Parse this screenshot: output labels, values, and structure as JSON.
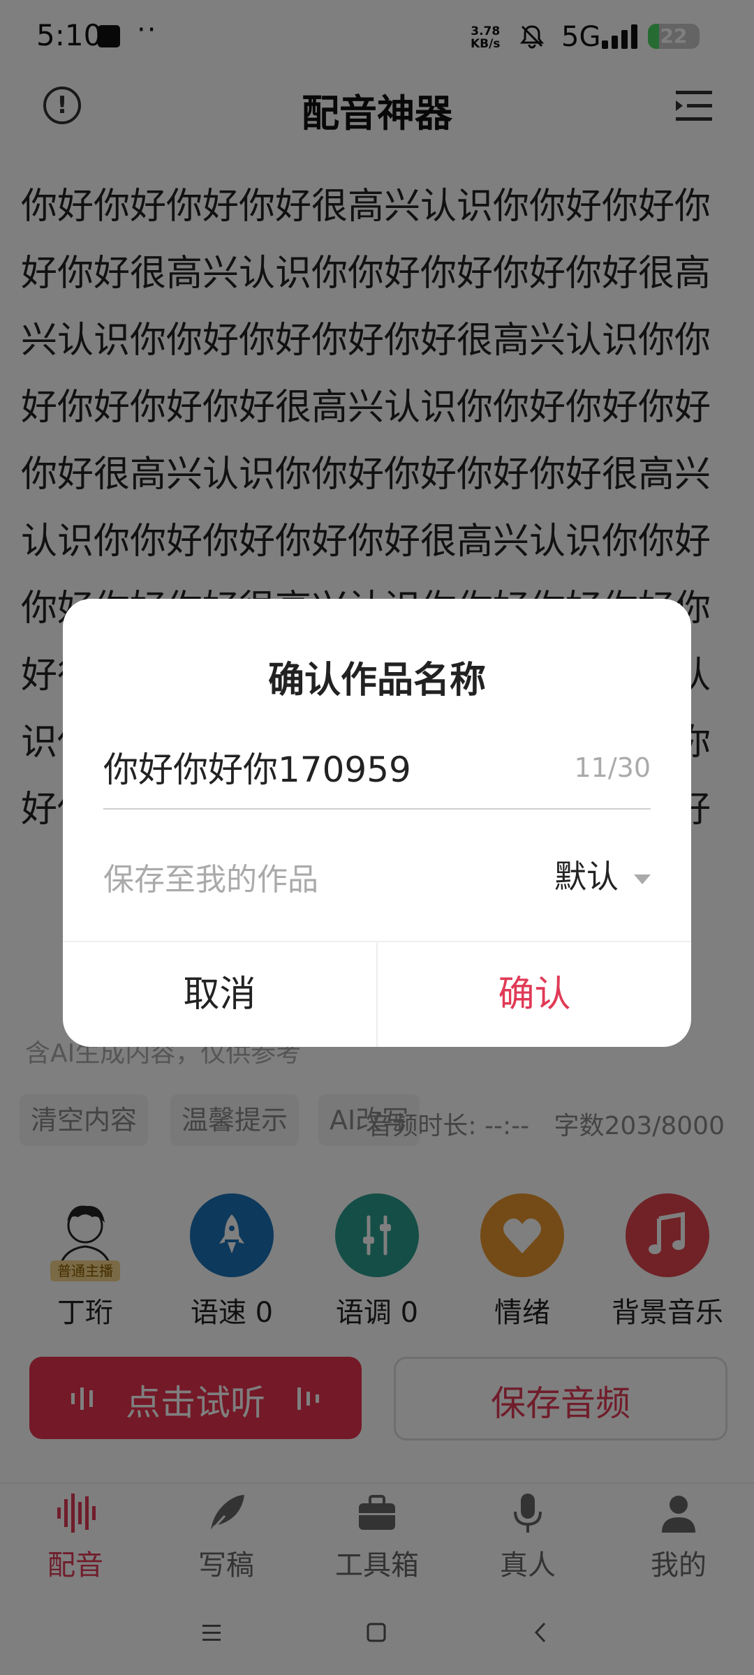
{
  "status_bar": {
    "time": "5:10",
    "dots": "··",
    "net_speed_value": "3.78",
    "net_speed_unit": "KB/s",
    "network": "5G",
    "battery": "22",
    "battery_level": 0.22,
    "icons": [
      "image-square-icon",
      "mute-bell-icon",
      "signal-icon",
      "battery-charging-icon"
    ]
  },
  "header": {
    "title": "配音神器",
    "icons": [
      "info-icon",
      "menu-icon"
    ]
  },
  "editor": {
    "text": "你好你好你好你好很高兴认识你你好你好你好你好很高兴认识你你好你好你好你好很高兴认识你你好你好你好你好很高兴认识你你好你好你好你好很高兴认识你你好你好你好你好很高兴认识你你好你好你好你好很高兴认识你你好你好你好你好很高兴认识你你好你好你好你好很高兴认识你你好你好你好你好很高兴认识你你好你好你好你好很高兴认识你你好你好你好你好很高兴认识你你好你好你好你好很高兴认识你你好你好你好你好",
    "ai_note": "含AI生成内容，仅供参考"
  },
  "actions": {
    "clear": "清空内容",
    "tips": "温馨提示",
    "ai_rewrite": "AI改写",
    "duration_label": "音频时长: --:--",
    "char_count": "字数203/8000"
  },
  "tools": [
    {
      "label": "丁珩",
      "badge": "普通主播",
      "icon": "voice-actor-avatar-icon"
    },
    {
      "label": "语速 0",
      "icon": "rocket-icon",
      "color": "#1a73b8"
    },
    {
      "label": "语调 0",
      "icon": "sliders-icon",
      "color": "#2a9d8f"
    },
    {
      "label": "情绪",
      "icon": "heart-icon",
      "color": "#e8962e"
    },
    {
      "label": "背景音乐",
      "icon": "music-note-icon",
      "color": "#e0444f"
    }
  ],
  "buttons": {
    "listen": "点击试听",
    "save_audio": "保存音频"
  },
  "bottom_nav": [
    {
      "label": "配音",
      "icon": "waveform-icon",
      "active": true
    },
    {
      "label": "写稿",
      "icon": "feather-icon",
      "active": false
    },
    {
      "label": "工具箱",
      "icon": "toolbox-icon",
      "active": false
    },
    {
      "label": "真人",
      "icon": "microphone-icon",
      "active": false
    },
    {
      "label": "我的",
      "icon": "person-icon",
      "active": false
    }
  ],
  "dialog": {
    "title": "确认作品名称",
    "name_value": "你好你好你170959",
    "name_count": "11/30",
    "save_to_label": "保存至我的作品",
    "folder_value": "默认",
    "cancel": "取消",
    "confirm": "确认"
  },
  "colors": {
    "accent": "#e03a56",
    "listen_button": "#e8334f"
  }
}
